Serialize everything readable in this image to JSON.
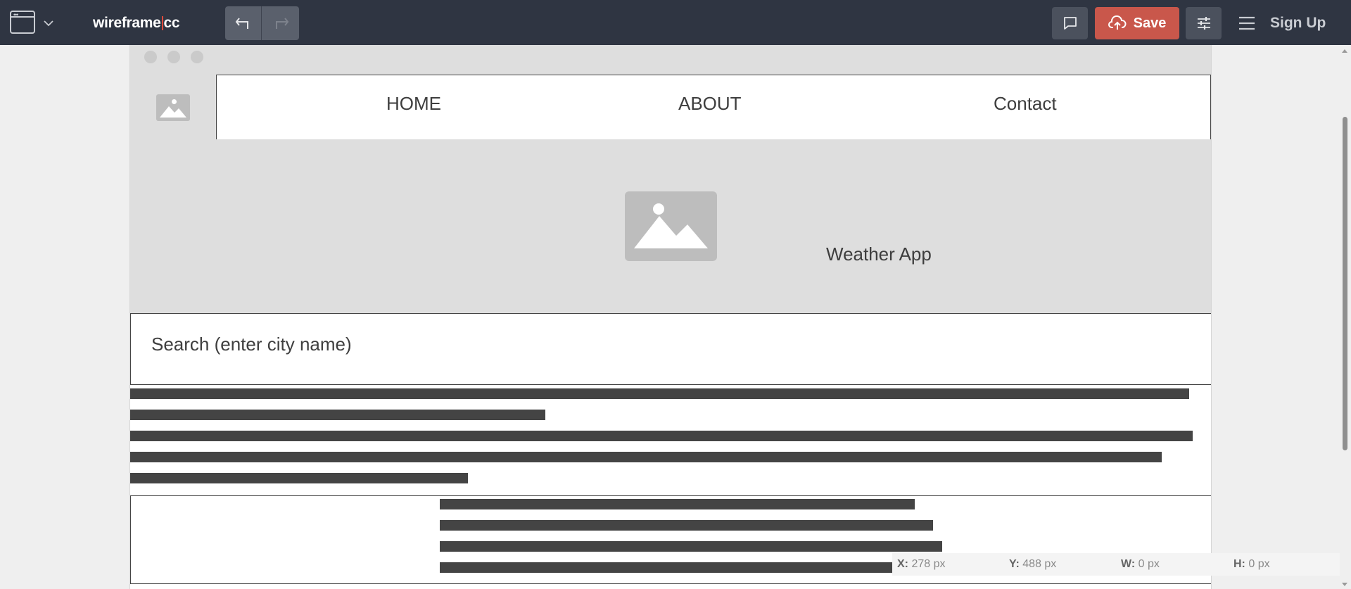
{
  "toolbar": {
    "logo_left": "wireframe",
    "logo_right": "cc",
    "save_label": "Save",
    "signup_label": "Sign Up"
  },
  "nav": {
    "items": [
      "HOME",
      "ABOUT",
      "Contact"
    ]
  },
  "hero": {
    "title": "Weather App"
  },
  "search": {
    "placeholder": "Search (enter city name)"
  },
  "coords": {
    "x_label": "X:",
    "x_value": "278 px",
    "y_label": "Y:",
    "y_value": "488 px",
    "w_label": "W:",
    "w_value": "0 px",
    "h_label": "H:",
    "h_value": "0 px"
  },
  "icons": {
    "window": "browser-window-icon",
    "chevron": "chevron-down-icon",
    "undo": "undo-icon",
    "redo": "redo-icon",
    "comment": "comment-icon",
    "cloud": "cloud-upload-icon",
    "settings": "sliders-icon",
    "menu": "hamburger-menu-icon",
    "image": "image-placeholder-icon"
  },
  "colors": {
    "toolbar_bg": "#2f3542",
    "save_bg": "#c9574b",
    "logo_accent": "#e04a3b",
    "wire_fill": "#dedede",
    "text_bar": "#444444"
  }
}
